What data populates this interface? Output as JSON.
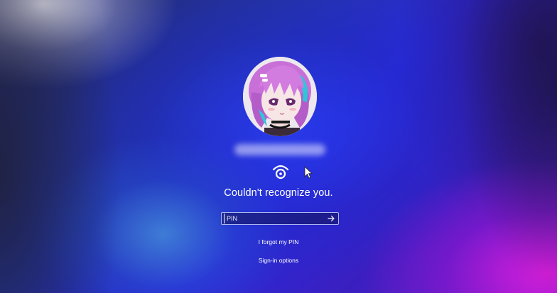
{
  "user": {
    "avatar": "anime-avatar-image"
  },
  "status": {
    "message": "Couldn't recognize you."
  },
  "pin_field": {
    "placeholder": "PIN",
    "submit_icon": "arrow-right-icon"
  },
  "links": {
    "forgot_pin": "I forgot my PIN",
    "sign_in_options": "Sign-in options"
  },
  "icons": {
    "face_recognition": "face-recognition-icon",
    "cursor": "mouse-pointer-icon"
  },
  "colors": {
    "text": "#ffffff",
    "field_border": "#bec8ff",
    "accent_blue": "#2a2ad8",
    "accent_magenta": "#dc1edc"
  }
}
